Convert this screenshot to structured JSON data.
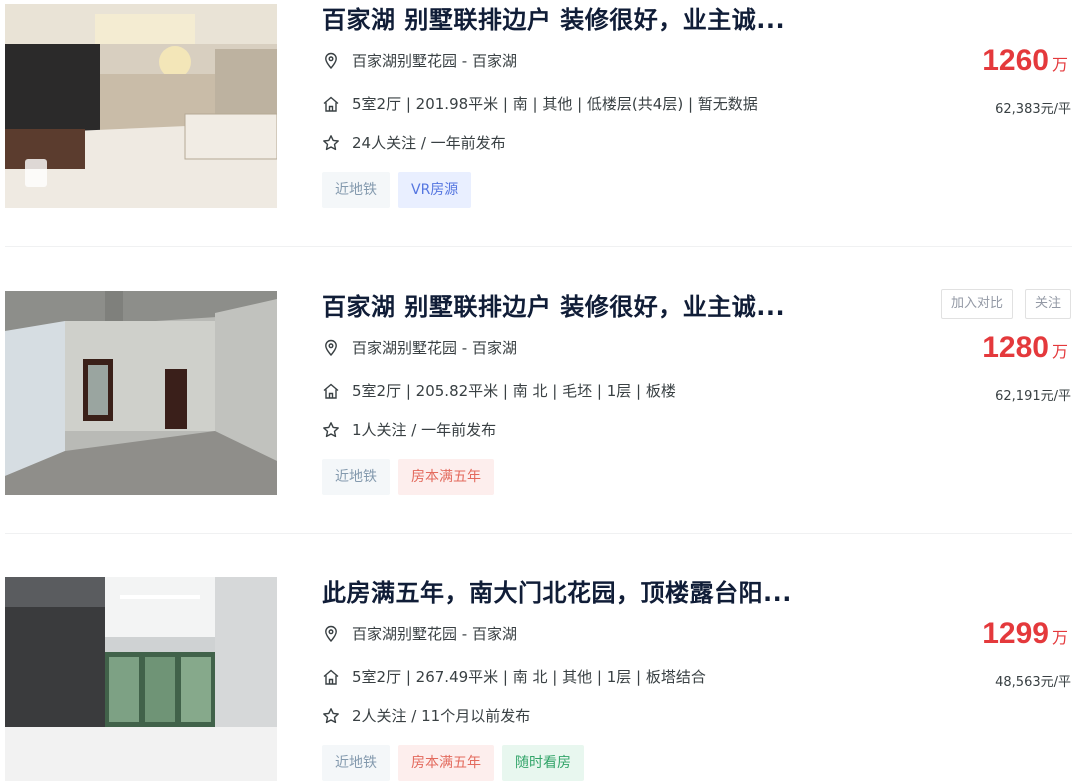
{
  "listings": [
    {
      "title": "百家湖 别墅联排边户 装修很好，业主诚...",
      "address": "百家湖别墅花园 - 百家湖",
      "info": "5室2厅 | 201.98平米 | 南 | 其他 | 低楼层(共4层) | 暂无数据",
      "follow": "24人关注 / 一年前发布",
      "price": "1260",
      "price_unit": "万",
      "unit_price": "62,383元/平",
      "tags": [
        {
          "label": "近地铁",
          "style": "gray"
        },
        {
          "label": "VR房源",
          "style": "blue"
        }
      ]
    },
    {
      "title": "百家湖 别墅联排边户 装修很好，业主诚...",
      "address": "百家湖别墅花园 - 百家湖",
      "info": "5室2厅 | 205.82平米 | 南 北 | 毛坯 | 1层 | 板楼",
      "follow": "1人关注 / 一年前发布",
      "price": "1280",
      "price_unit": "万",
      "unit_price": "62,191元/平",
      "compare_label": "加入对比",
      "favorite_label": "关注",
      "tags": [
        {
          "label": "近地铁",
          "style": "gray"
        },
        {
          "label": "房本满五年",
          "style": "red"
        }
      ]
    },
    {
      "title": "此房满五年，南大门北花园，顶楼露台阳...",
      "address": "百家湖别墅花园 - 百家湖",
      "info": "5室2厅 | 267.49平米 | 南 北 | 其他 | 1层 | 板塔结合",
      "follow": "2人关注 / 11个月以前发布",
      "price": "1299",
      "price_unit": "万",
      "unit_price": "48,563元/平",
      "tags": [
        {
          "label": "近地铁",
          "style": "gray"
        },
        {
          "label": "房本满五年",
          "style": "red"
        },
        {
          "label": "随时看房",
          "style": "green"
        }
      ]
    }
  ],
  "icons": {
    "address": "location-pin-icon",
    "info": "house-icon",
    "follow": "star-icon"
  },
  "colors": {
    "price": "#e4393c",
    "title": "#101d37"
  }
}
